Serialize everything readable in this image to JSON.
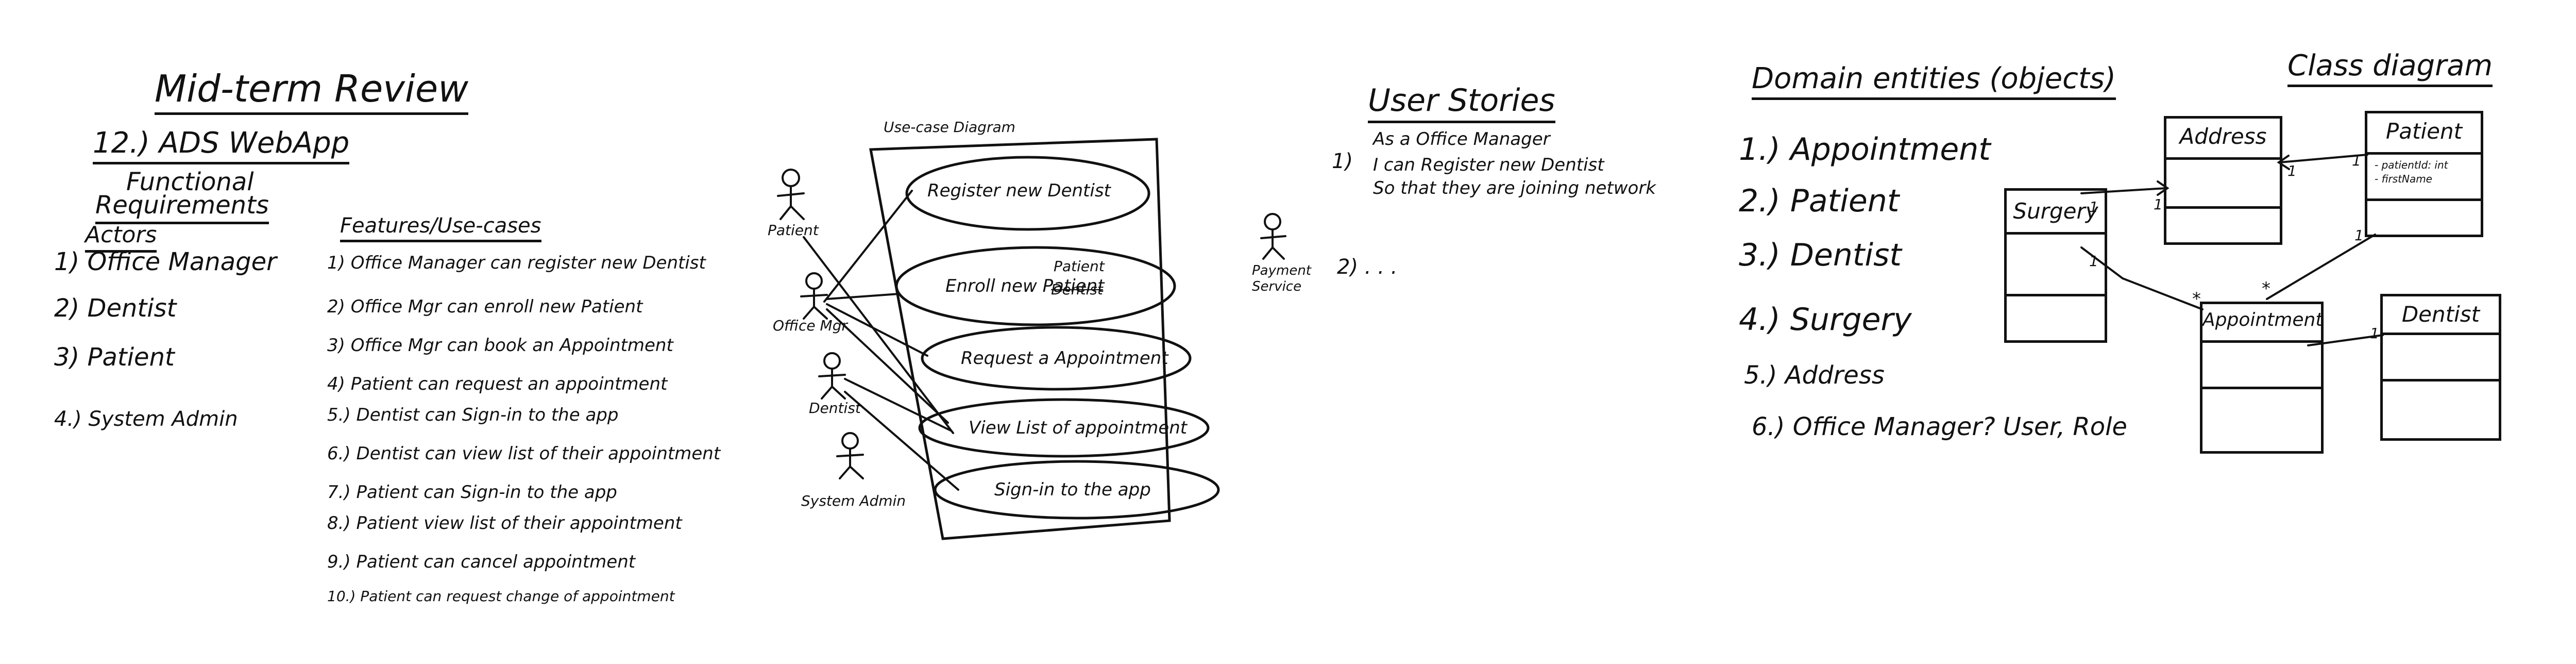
{
  "review": {
    "title": "Mid-term Review",
    "subtitle": "12.) ADS WebApp",
    "functional_line1": "Functional",
    "functional_line2": "Requirements",
    "actors_heading": "Actors",
    "actors": [
      "1) Office Manager",
      "2) Dentist",
      "3) Patient",
      "4.) System Admin"
    ]
  },
  "features": {
    "heading": "Features/Use-cases",
    "items": [
      "1) Office Manager can register new Dentist",
      "2) Office Mgr can enroll new Patient",
      "3) Office Mgr can book an Appointment",
      "4) Patient can request an appointment",
      "5.) Dentist can Sign-in to the app",
      "6.) Dentist can view list of their appointment",
      "7.) Patient can Sign-in to the app",
      "8.) Patient view list of their appointment",
      "9.) Patient can cancel appointment",
      "10.) Patient can request change of appointment"
    ]
  },
  "usecase_diagram": {
    "label": "Use-case Diagram",
    "actors": [
      "Patient",
      "Office Mgr",
      "Dentist",
      "System Admin",
      "Payment Service"
    ],
    "usecases": [
      "Register new Dentist",
      "Enroll new Patient",
      "Request a Appointment",
      "View List of appointment",
      "Sign-in to the app"
    ],
    "enroll_struck": "Dentist",
    "enroll_correction": "Patient"
  },
  "user_stories": {
    "heading": "User Stories",
    "story1_num": "1)",
    "story1_lines": [
      "As a Office Manager",
      "I can Register new Dentist",
      "So that they are joining network"
    ],
    "story2": "2) . . ."
  },
  "domain": {
    "heading": "Domain entities (objects)",
    "items": [
      "1.) Appointment",
      "2.) Patient",
      "3.) Dentist",
      "4.) Surgery",
      "5.) Address",
      "6.) Office Manager? User, Role"
    ]
  },
  "class_diagram": {
    "heading": "Class diagram",
    "classes": {
      "address": "Address",
      "patient": "Patient",
      "surgery": "Surgery",
      "appointment": "Appointment",
      "dentist": "Dentist"
    },
    "patient_attrs": [
      "- patientId: int",
      "- firstName"
    ],
    "multiplicities": {
      "surgery_address": "1",
      "address_end": "1",
      "patient_address": "1",
      "address_patient_end": "1",
      "surgery_appt": "1",
      "appt_star_left": "*",
      "appt_star_right": "*",
      "patient_appt": "1",
      "dentist_appt": "1"
    }
  }
}
